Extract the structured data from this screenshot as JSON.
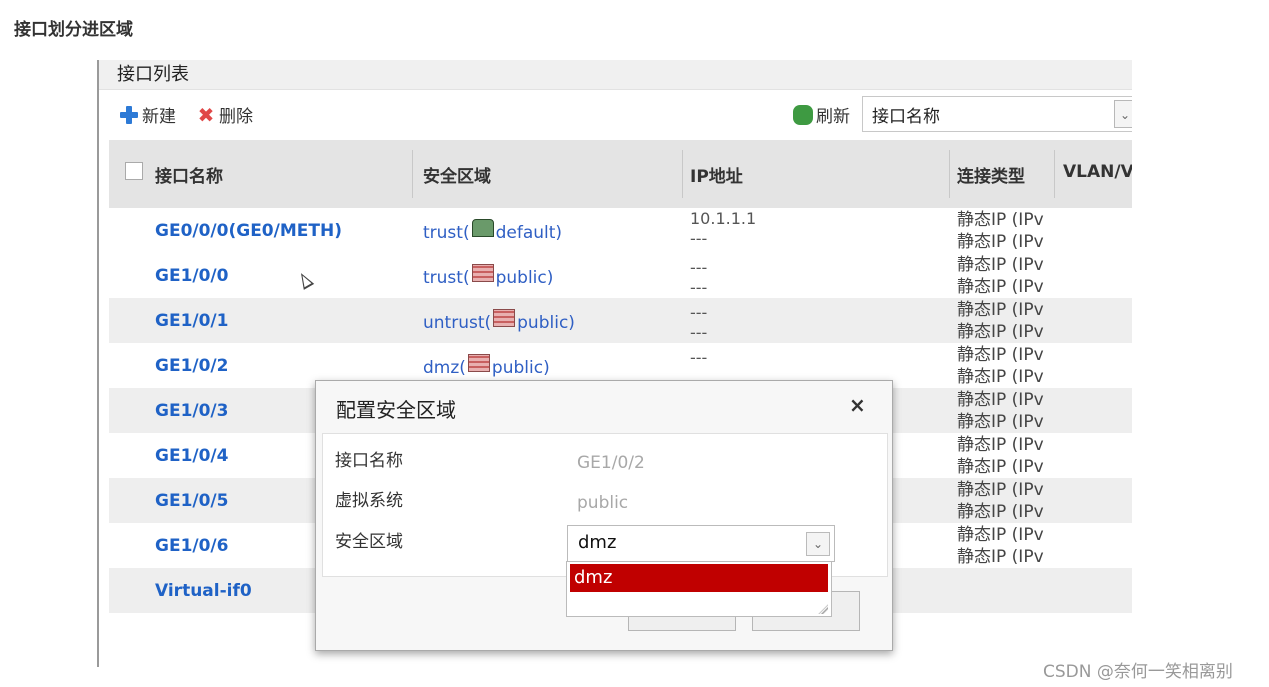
{
  "heading": "接口划分进区域",
  "panel": {
    "title": "接口列表",
    "toolbar": {
      "new_label": "新建",
      "delete_label": "删除",
      "refresh_label": "刷新",
      "search_field": "接口名称"
    }
  },
  "table": {
    "columns": [
      "接口名称",
      "安全区域",
      "IP地址",
      "连接类型",
      "VLAN/V"
    ],
    "rows": [
      {
        "name": "GE0/0/0(GE0/METH)",
        "zone": "trust(",
        "vsys": "default)",
        "ip": [
          "10.1.1.1",
          "---"
        ],
        "conn": [
          "静态IP (IPv",
          "静态IP (IPv"
        ]
      },
      {
        "name": "GE1/0/0",
        "zone": "trust(",
        "vsys": "public)",
        "ip": [
          "---",
          "---"
        ],
        "conn": [
          "静态IP (IPv",
          "静态IP (IPv"
        ]
      },
      {
        "name": "GE1/0/1",
        "zone": "untrust(",
        "vsys": "public)",
        "ip": [
          "---",
          "---"
        ],
        "conn": [
          "静态IP (IPv",
          "静态IP (IPv"
        ]
      },
      {
        "name": "GE1/0/2",
        "zone": "dmz(",
        "vsys": "public)",
        "ip": [
          "---"
        ],
        "conn": [
          "静态IP (IPv",
          "静态IP (IPv"
        ]
      },
      {
        "name": "GE1/0/3",
        "conn": [
          "静态IP (IPv",
          "静态IP (IPv"
        ]
      },
      {
        "name": "GE1/0/4",
        "conn": [
          "静态IP (IPv",
          "静态IP (IPv"
        ]
      },
      {
        "name": "GE1/0/5",
        "conn": [
          "静态IP (IPv",
          "静态IP (IPv"
        ]
      },
      {
        "name": "GE1/0/6",
        "conn": [
          "静态IP (IPv",
          "静态IP (IPv"
        ]
      },
      {
        "name": "Virtual-if0"
      }
    ]
  },
  "dialog": {
    "title": "配置安全区域",
    "close": "×",
    "fields": {
      "interface_label": "接口名称",
      "interface_value": "GE1/0/2",
      "vsys_label": "虚拟系统",
      "vsys_value": "public",
      "zone_label": "安全区域",
      "zone_value": "dmz"
    },
    "dropdown_option": "dmz"
  },
  "watermark": "CSDN @奈何一笑相离别"
}
